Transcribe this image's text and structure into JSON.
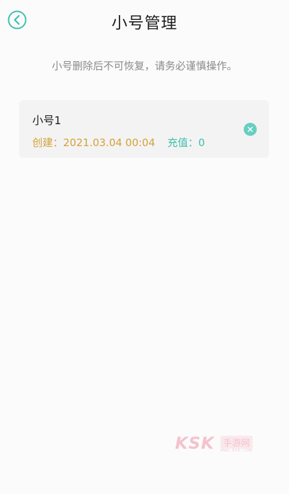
{
  "header": {
    "title": "小号管理",
    "back_icon": "chevron-left-icon"
  },
  "notice": "小号删除后不可恢复，请务必谨慎操作。",
  "accounts": [
    {
      "name": "小号1",
      "created_label": "创建：",
      "created_value": "2021.03.04 00:04",
      "recharge_label": "充值：",
      "recharge_value": "0",
      "delete_icon": "close-icon"
    }
  ],
  "watermark": {
    "brand": "KSK",
    "text": "手游网",
    "url": "www.ksk.com"
  },
  "colors": {
    "accent": "#3ebfae",
    "created_text": "#d3a23a",
    "title_text": "#1f1f1f",
    "notice_text": "#8a8a8a",
    "card_bg": "#f3f3f3",
    "watermark": "#e85a7a"
  }
}
